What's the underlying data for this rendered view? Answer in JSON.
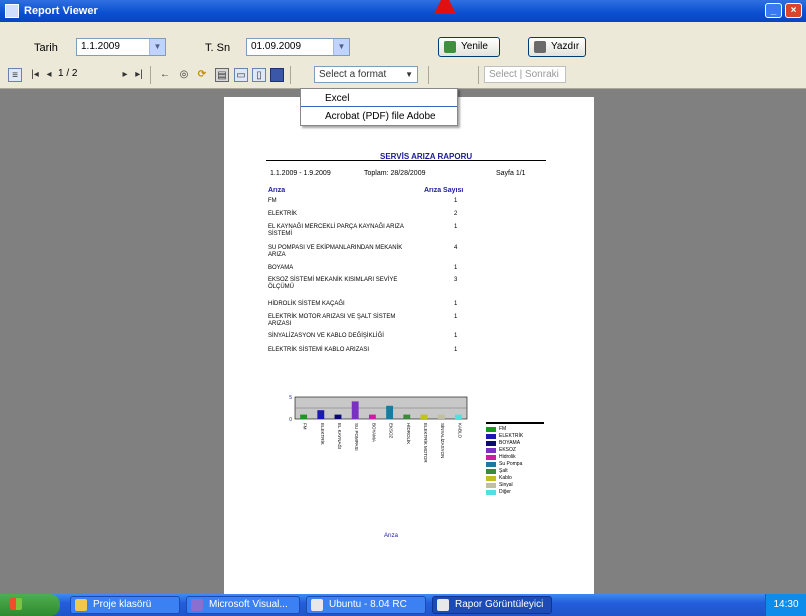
{
  "window": {
    "title": "Report Viewer"
  },
  "filters": {
    "start_label": "Tarih",
    "start_value": "1.1.2009",
    "end_label": "T. Sn",
    "end_value": "01.09.2009",
    "refresh_label": "Yenile",
    "print_label": "Yazdır"
  },
  "toolbar": {
    "page_current": "1",
    "page_of": "/ 2",
    "export_selected": "Select a format",
    "search_placeholder": "Select | Sonraki"
  },
  "export_menu": {
    "items": [
      "Excel",
      "Acrobat (PDF) file Adobe"
    ]
  },
  "report": {
    "title": "SERVİS ARIZA RAPORU",
    "meta": [
      "1.1.2009 - 1.9.2009",
      "Toplam: 28/28/2009",
      "Sayfa 1/1"
    ],
    "col_item": "Arıza",
    "col_count": "Arıza Sayısı",
    "rows": [
      {
        "name": "FM",
        "count": "1"
      },
      {
        "name": "ELEKTRİK",
        "count": "2"
      },
      {
        "name": "EL KAYNAĞI MERCEKLİ PARÇA KAYNAĞI ARIZA SİSTEMİ",
        "count": "1"
      },
      {
        "name": "SU POMPASI VE EKİPMANLARINDAN MEKANİK ARIZA",
        "count": "4"
      },
      {
        "name": "BOYAMA",
        "count": "1"
      },
      {
        "name": "EKSOZ SİSTEMİ MEKANİK KISIMLARI SEVİYE ÖLÇÜMÜ",
        "count": "3"
      },
      {
        "name": "HİDROLİK SİSTEM KAÇAĞI",
        "count": "1"
      },
      {
        "name": "ELEKTRİK MOTOR ARIZASI VE ŞALT SİSTEM ARIZASI",
        "count": "1"
      },
      {
        "name": "SİNYALİZASYON VE KABLO DEĞİŞİKLİĞİ",
        "count": "1"
      },
      {
        "name": "ELEKTRİK SİSTEMİ KABLO ARIZASI",
        "count": "1"
      }
    ],
    "x_axis_label": "Arıza",
    "legend": [
      {
        "label": "FM",
        "color": "#1a9a1a"
      },
      {
        "label": "ELEKTRİK",
        "color": "#1a1ab0"
      },
      {
        "label": "BOYAMA",
        "color": "#0a0a70"
      },
      {
        "label": "EKSOZ",
        "color": "#7a30c0"
      },
      {
        "label": "Hidrolik",
        "color": "#d01aa0"
      },
      {
        "label": "Su Pompa",
        "color": "#1a7aa0"
      },
      {
        "label": "Şalt",
        "color": "#3a8a3a"
      },
      {
        "label": "Kablo",
        "color": "#c0c020"
      },
      {
        "label": "Sinyal",
        "color": "#c0c0a0"
      },
      {
        "label": "Diğer",
        "color": "#50e0e0"
      }
    ]
  },
  "chart_data": {
    "type": "bar",
    "categories": [
      "FM",
      "ELEKTRİK",
      "EL KAYNAĞI",
      "SU POMPASI",
      "BOYAMA",
      "EKSOZ",
      "HİDROLİK",
      "ELEKTRİK MOTOR",
      "SİNYALİZASYON",
      "KABLO"
    ],
    "values": [
      1,
      2,
      1,
      4,
      1,
      3,
      1,
      1,
      1,
      1
    ],
    "ylim": [
      0,
      5
    ],
    "xlabel": "Arıza",
    "ylabel": ""
  },
  "taskbar": {
    "items": [
      "Proje klasörü",
      "Microsoft Visual...",
      "Ubuntu - 8.04 RC",
      "Rapor Görüntüleyici"
    ],
    "clock": "14:30"
  }
}
